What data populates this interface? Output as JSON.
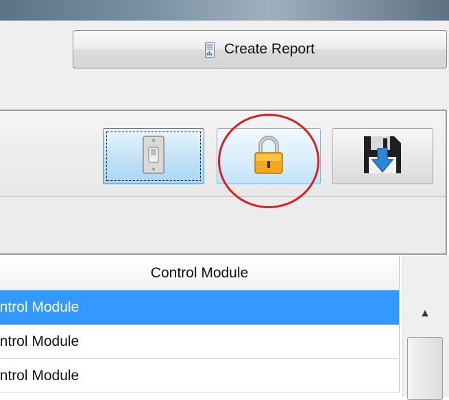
{
  "window": {
    "title_bar_color": "#6b8191"
  },
  "report": {
    "button_label": "Create Report",
    "icon": "report-icon"
  },
  "toolbar": {
    "buttons": [
      {
        "name": "switch",
        "icon": "light-switch-icon",
        "state": "focused"
      },
      {
        "name": "lock",
        "icon": "padlock-icon",
        "state": "hover-highlighted"
      },
      {
        "name": "save",
        "icon": "floppy-download-icon",
        "state": "normal"
      }
    ],
    "annotation_color": "#e01b1b"
  },
  "table": {
    "column_header": "Control Module",
    "rows": [
      {
        "label": "ontrol Module",
        "selected": true
      },
      {
        "label": "ontrol Module",
        "selected": false
      },
      {
        "label": "ontrol Module",
        "selected": false
      }
    ],
    "selection_color": "#3399ff"
  },
  "scrollbar": {
    "up_arrow": "▲"
  }
}
